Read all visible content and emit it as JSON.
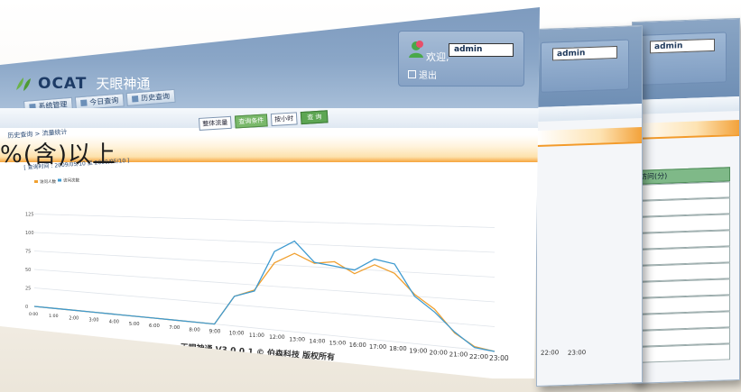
{
  "app": {
    "brand": "OCAT",
    "name_cn": "天眼神通",
    "nav_tabs": [
      "系统管理",
      "今日查询",
      "历史查询"
    ]
  },
  "user_panel": {
    "welcome": "欢迎,",
    "username": "admin",
    "logout": "退出"
  },
  "controls": {
    "select1": "整体流量",
    "label": "查询条件",
    "select2": "按小时",
    "query_button": "查 询"
  },
  "breadcrumb": "历史查询 > 流量统计",
  "subinfo": "[ 查询时间 : 2009/05/10 至 2009/05/10 ]",
  "overlay_text": "%(含)以上",
  "footer": "天眼神通 V3.0.0.1 © 伯森科技 版权所有",
  "back_windows": [
    {
      "username": "admin",
      "times": [
        "22:00",
        "23:00"
      ]
    },
    {
      "username": "admin",
      "table_header": "访问(分)"
    }
  ],
  "colors": {
    "series1": "#f0a030",
    "series2": "#3e9ad0",
    "header_blue": "#7c99bd",
    "accent_orange": "#f39b2b"
  },
  "chart_data": {
    "type": "line",
    "categories": [
      "0:00",
      "1:00",
      "2:00",
      "3:00",
      "4:00",
      "5:00",
      "6:00",
      "7:00",
      "8:00",
      "9:00",
      "10:00",
      "11:00",
      "12:00",
      "13:00",
      "14:00",
      "15:00",
      "16:00",
      "17:00",
      "18:00",
      "19:00",
      "20:00",
      "21:00",
      "22:00",
      "23:00"
    ],
    "x_tick_labels": [
      "0:00",
      "1:00",
      "2:00",
      "3:00",
      "4:00",
      "5:00",
      "6:00",
      "7:00",
      "8:00",
      "9:00",
      "10:00",
      "11:00",
      "12:00",
      "13:00",
      "14:00",
      "15:00",
      "16:00",
      "17:00",
      "18:00",
      "19:00",
      "20:00",
      "21:00",
      "22:00",
      "23:00"
    ],
    "y_tick_labels": [
      "0",
      "25",
      "50",
      "75",
      "100",
      "125"
    ],
    "ylim": [
      0,
      125
    ],
    "series": [
      {
        "name": "访问人数",
        "values": [
          0,
          0,
          0,
          0,
          0,
          0,
          0,
          0,
          0,
          0,
          35,
          44,
          77,
          89,
          79,
          82,
          70,
          81,
          73,
          52,
          38,
          15,
          3,
          0
        ]
      },
      {
        "name": "访问次数",
        "values": [
          0,
          0,
          0,
          0,
          0,
          0,
          0,
          0,
          0,
          0,
          35,
          43,
          90,
          103,
          80,
          77,
          74,
          87,
          83,
          50,
          35,
          16,
          2,
          0
        ]
      }
    ],
    "legend_position": "top-left",
    "grid": true
  }
}
